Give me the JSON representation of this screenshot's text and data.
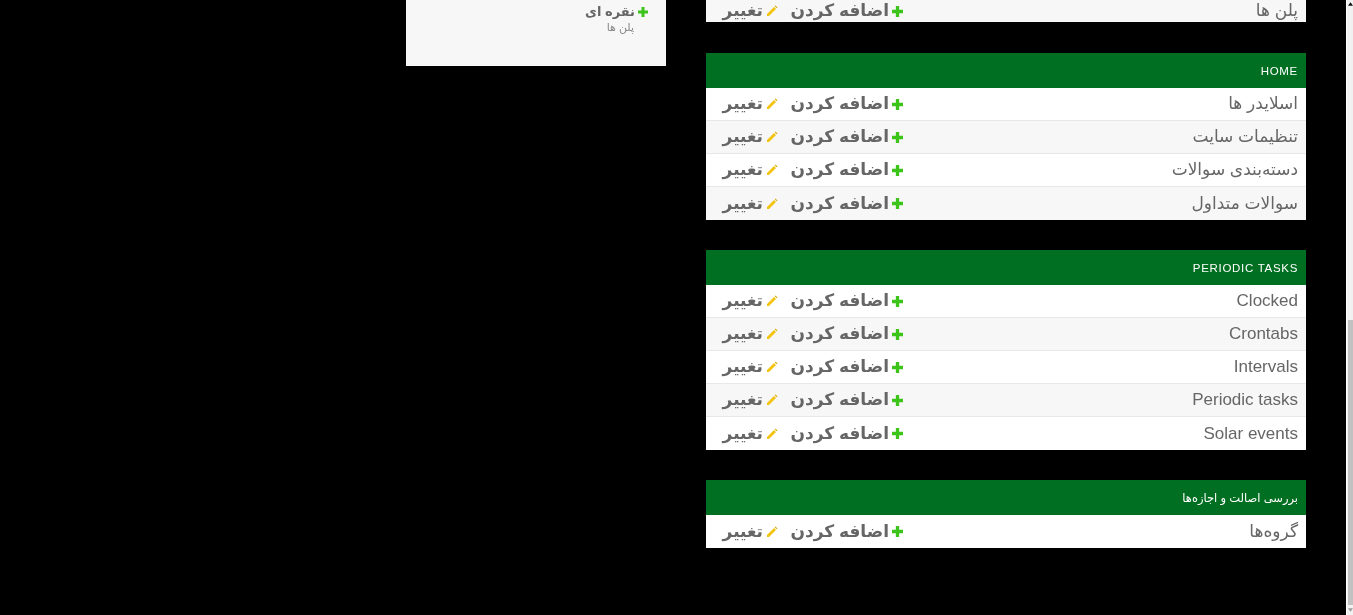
{
  "recent_actions": [
    {
      "kind": "addition",
      "title": "نقره ای",
      "content_type": "پلن ها"
    }
  ],
  "sections": [
    {
      "rows": [
        {
          "name": "پلن ها",
          "add": "اضافه کردن",
          "change": "تغییر"
        }
      ]
    },
    {
      "title": "HOME",
      "rows": [
        {
          "name": "اسلایدر ها",
          "add": "اضافه کردن",
          "change": "تغییر"
        },
        {
          "name": "تنظیمات سایت",
          "add": "اضافه کردن",
          "change": "تغییر"
        },
        {
          "name": "دسته‌بندی سوالات",
          "add": "اضافه کردن",
          "change": "تغییر"
        },
        {
          "name": "سوالات متداول",
          "add": "اضافه کردن",
          "change": "تغییر"
        }
      ]
    },
    {
      "title": "PERIODIC TASKS",
      "rows": [
        {
          "name": "Clocked",
          "add": "اضافه کردن",
          "change": "تغییر"
        },
        {
          "name": "Crontabs",
          "add": "اضافه کردن",
          "change": "تغییر"
        },
        {
          "name": "Intervals",
          "add": "اضافه کردن",
          "change": "تغییر"
        },
        {
          "name": "Periodic tasks",
          "add": "اضافه کردن",
          "change": "تغییر"
        },
        {
          "name": "Solar events",
          "add": "اضافه کردن",
          "change": "تغییر"
        }
      ]
    },
    {
      "title": "بررسی اصالت و اجازه‌ها",
      "rows": [
        {
          "name": "گروه‌ها",
          "add": "اضافه کردن",
          "change": "تغییر"
        }
      ]
    }
  ]
}
